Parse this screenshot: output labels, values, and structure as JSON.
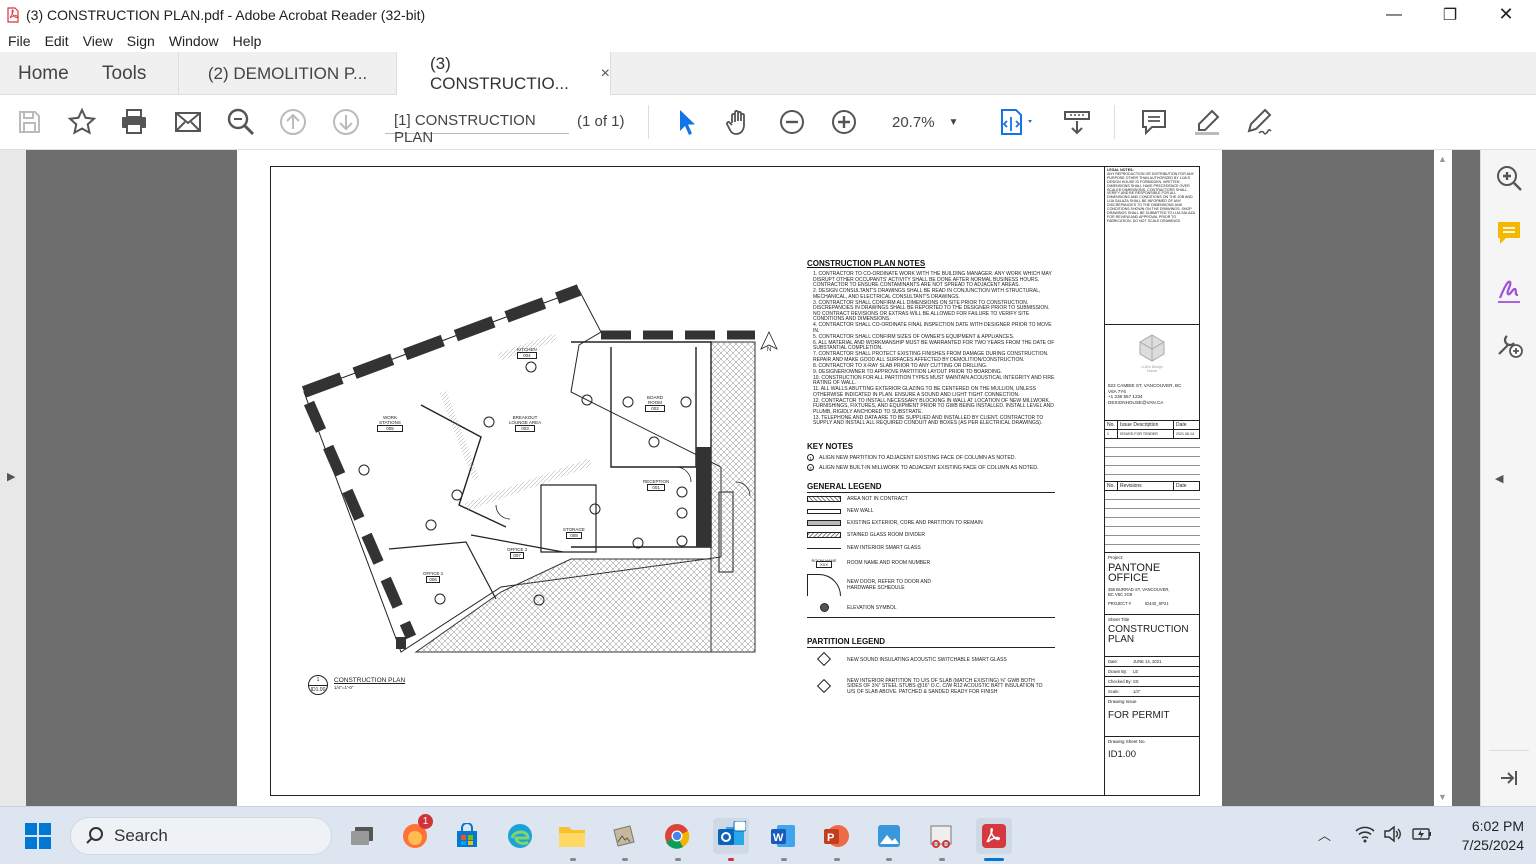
{
  "window": {
    "title": "(3) CONSTRUCTION PLAN.pdf - Adobe Acrobat Reader (32-bit)",
    "minimize": "—",
    "maximize": "❐",
    "close": "✕"
  },
  "menu": [
    "File",
    "Edit",
    "View",
    "Sign",
    "Window",
    "Help"
  ],
  "tabs": {
    "home": "Home",
    "tools": "Tools",
    "doc1": "(2) DEMOLITION P...",
    "doc2": "(3) CONSTRUCTIO...",
    "close_glyph": "×"
  },
  "toolbar": {
    "page_label": "[1] CONSTRUCTION PLAN",
    "page_count": "(1 of 1)",
    "zoom": "20.7%"
  },
  "drawing": {
    "notes_title": "CONSTRUCTION PLAN NOTES",
    "notes": [
      "1.  CONTRACTOR TO CO-ORDINATE WORK WITH THE BUILDING MANAGER. ANY WORK WHICH MAY DISRUPT OTHER OCCUPANTS' ACTIVITY SHALL BE DONE AFTER NORMAL BUSINESS HOURS. CONTRACTOR TO ENSURE CONTAMINANTS ARE NOT SPREAD TO ADJACENT AREAS.",
      "2.  DESIGN CONSULTANT'S DRAWINGS SHALL BE READ IN CONJUNCTION WITH STRUCTURAL, MECHANICAL, AND ELECTRICAL CONSULTANT'S DRAWINGS.",
      "3.  CONTRACTOR SHALL CONFIRM ALL DIMENSIONS ON SITE PRIOR TO CONSTRUCTION. DISCREPANCIES IN DRAWINGS SHALL BE REPORTED TO THE DESIGNER PRIOR TO SUBMISSION. NO CONTRACT REVISIONS OR EXTRAS WILL BE ALLOWED FOR FAILURE TO VERIFY SITE CONDITIONS AND DIMENSIONS.",
      "4.  CONTRACTOR SHALL CO-ORDINATE FINAL INSPECTION DATE WITH DESIGNER PRIOR TO MOVE IN.",
      "5.  CONTRACTOR SHALL CONFIRM SIZES OF OWNER'S EQUIPMENT & APPLIANCES.",
      "6.  ALL MATERIAL AND WORKMANSHIP MUST BE WARRANTED FOR TWO YEARS FROM THE DATE OF SUBSTANTIAL COMPLETION.",
      "7.  CONTRACTOR SHALL PROTECT EXISTING FINISHES FROM DAMAGE DURING CONSTRUCTION. REPAIR AND MAKE GOOD ALL SURFACES AFFECTED BY DEMOLITION/CONSTRUCTION.",
      "8.  CONTRACTOR TO X-RAY SLAB PRIOR TO ANY CUTTING OR DRILLING.",
      "9.  DESIGNER/OWNER TO APPROVE PARTITION LAYOUT PRIOR TO BOARDING.",
      "10. CONSTRUCTION FOR ALL PARTITION TYPES MUST MAINTAIN ACOUSTICAL INTEGRITY AND FIRE RATING OF WALL.",
      "11. ALL WALLS ABUTTING EXTERIOR GLAZING TO BE CENTERED ON THE MULLION, UNLESS OTHERWISE INDICATED IN PLAN. ENSURE A SOUND AND LIGHT TIGHT CONNECTION.",
      "12. CONTRACTOR TO INSTALL NECESSARY BLOCKING IN WALL AT LOCATION OF NEW MILLWORK, FURNISHINGS, FIXTURES, AND EQUIPMENT PRIOR TO GWB BEING INSTALLED. INSTALL LEVEL AND PLUMB, RIGIDLY ANCHORED TO SUBSTRATE.",
      "13. TELEPHONE AND DATA ARE TO BE SUPPLIED AND INSTALLED BY CLIENT. CONTRACTOR TO SUPPLY AND INSTALL ALL REQUIRED CONDUIT AND BOXES (AS PER ELECTRICAL DRAWINGS)."
    ],
    "key_notes_title": "KEY NOTES",
    "key_notes": [
      "ALIGN NEW PARTITION TO ADJACENT EXISTING FACE OF COLUMN AS NOTED.",
      "ALIGN NEW BUILT-IN MILLWORK TO ADJACENT EXISTING FACE OF COLUMN AS NOTED."
    ],
    "general_legend_title": "GENERAL LEGEND",
    "general_legend": [
      "AREA NOT IN CONTRACT",
      "NEW WALL",
      "EXISTING EXTERIOR, CORE AND PARTITION TO REMAIN",
      "STAINED GLASS ROOM DIVIDER",
      "NEW INTERIOR SMART GLASS",
      "ROOM NAME AND ROOM NUMBER",
      "NEW DOOR, REFER TO DOOR AND HARDWARE SCHEDULE",
      "ELEVATION SYMBOL"
    ],
    "room_tag_name": "ROOM NAME",
    "room_tag_num": "XXX",
    "partition_legend_title": "PARTITION LEGEND",
    "partition_legend": [
      "NEW SOUND INSULATING ACOUSTIC SWITCHABLE SMART GLASS",
      "NEW INTERIOR PARTITION TO U/S OF SLAB (MATCH EXISTING) ⅝\" GWB BOTH SIDES OF 3⅝\" STEEL STUBS @16\" O.C. C/W R12 ACOUSTIC BATT INSULATION TO U/S OF SLAB ABOVE. PATCHED & SANDED READY FOR FINISH"
    ],
    "plan_title": "CONSTRUCTION PLAN",
    "plan_scale": "1/4\"=1'-0\"",
    "plan_ref_num": "1",
    "plan_ref_sheet": "ID1.00",
    "north": "N",
    "rooms": [
      {
        "name": "KITCHEN",
        "num": "004"
      },
      {
        "name": "WORK STATIONS",
        "num": "005"
      },
      {
        "name": "BREAKOUT LOUNGE AREA",
        "num": "003"
      },
      {
        "name": "BOARD ROOM",
        "num": "002"
      },
      {
        "name": "RECEPTION",
        "num": "001"
      },
      {
        "name": "STORAGE",
        "num": "008"
      },
      {
        "name": "OFFICE 2",
        "num": "007"
      },
      {
        "name": "OFFICE 1",
        "num": "006"
      }
    ],
    "legal_title": "LEGAL NOTES:",
    "legal_text": "ANY REPRODUCTION OR DISTRIBUTION FOR ANY PURPOSE OTHER THAN AUTHORIZED BY LIJA'S DESIGN HOUSE IS FORBIDDEN. WRITTEN DIMENSIONS SHALL HAVE PRECEDENCE OVER SCALED DIMENSIONS. CONTRACTORS SHALL VERIFY AND BE RESPONSIBLE FOR ALL DIMENSIONS AND CONDITIONS ON THE JOB AND LIJA SALAZA SHALL BE INFORMED OF ANY DISCREPANCIES TO THE DIMENSIONS AND CONDITIONS SHOWN ON THE DRAWINGS. SHOP DRAWINGS SHALL BE SUBMITTED TO LIJA SALAZA FOR REVIEW AND APPROVAL PRIOR TO FABRICATION. DO NOT SCALE DRAWINGS",
    "firm_logo_text": "LIJA's Design House",
    "firm_address": [
      "822 CAMBIE ST, VANCOUVER, BC",
      "V6A 7Y6",
      "+1 236 567 1234",
      "DESIGNHOUSE@VAN.CA"
    ],
    "issue_headers": [
      "No.",
      "Issue Description",
      "Date"
    ],
    "issue_row": [
      "1",
      "ISSUED FOR TENDER",
      "2021.06.14"
    ],
    "rev_headers": [
      "No.",
      "Revisions",
      "Date"
    ],
    "project_label": "Project:",
    "project_name_1": "PANTONE",
    "project_name_2": "OFFICE",
    "project_address": "355 BURRAD ST, VANCOUVER, BC V6C 2G8",
    "project_no_label": "PROJECT #",
    "project_no": "ID440_SP21",
    "sheet_title_label": "Sheet Title",
    "sheet_title_1": "CONSTRUCTION",
    "sheet_title_2": "PLAN",
    "date_label": "Date:",
    "date_value": "JUNE 14, 2021",
    "drawn_label": "Drawn By:",
    "drawn_value": "LE",
    "checked_label": "Checked By:",
    "checked_value": "SS",
    "scale_label": "Scale:",
    "scale_value": "1/4\"",
    "issue_label": "Drawing Issue",
    "issue_value": "FOR  PERMIT",
    "sheet_no_label": "Drawing Sheet No.",
    "sheet_no": "ID1.00"
  },
  "taskbar": {
    "search": "Search",
    "time": "6:02 PM",
    "date": "7/25/2024",
    "badge": "1"
  },
  "colors": {
    "accent_blue": "#1473e6",
    "acrobat_red": "#d7373f",
    "workarea_gray": "#6e6e6e"
  },
  "icons": [
    "pdf-file-icon",
    "save-icon",
    "star-icon",
    "print-icon",
    "mail-icon",
    "search-zoom-icon",
    "page-up-icon",
    "page-down-icon",
    "select-arrow-icon",
    "hand-icon",
    "zoom-out-icon",
    "zoom-in-icon",
    "fit-page-icon",
    "reading-mode-icon",
    "comment-icon",
    "highlight-icon",
    "sign-icon",
    "zoom-panel-icon",
    "comment-panel-icon",
    "fill-sign-icon",
    "more-tools-icon",
    "windows-start-icon",
    "search-icon"
  ]
}
